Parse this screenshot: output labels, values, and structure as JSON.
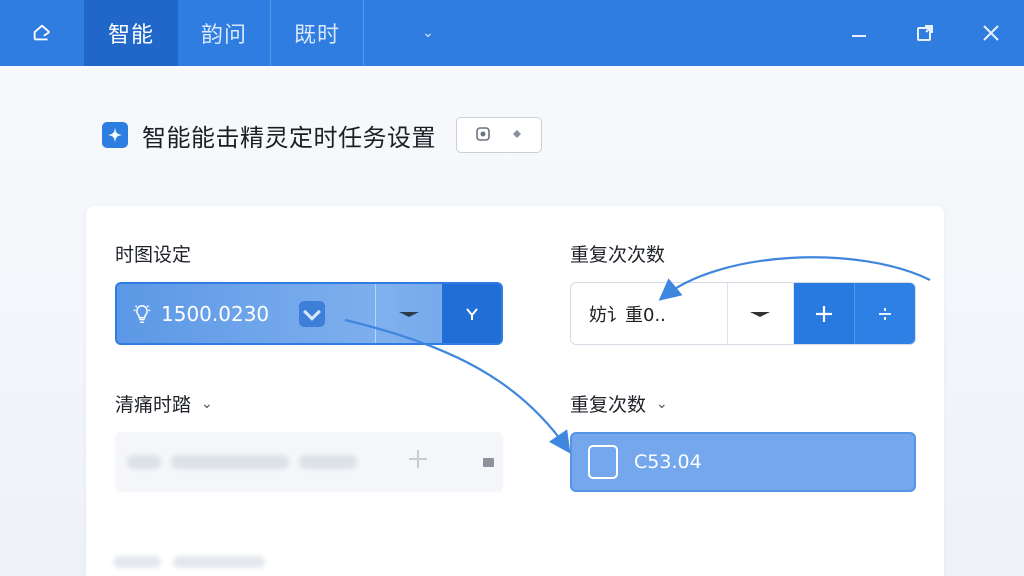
{
  "topbar": {
    "tabs": [
      {
        "label": "智能",
        "active": true
      },
      {
        "label": "韵问",
        "active": false
      },
      {
        "label": "既时",
        "active": false
      }
    ],
    "dropdown_glyph": "⌄"
  },
  "header": {
    "title": "智能能击精灵定时任务设置"
  },
  "form": {
    "time_label": "时图设定",
    "time_value": "1500.0230",
    "repeat_label": "重复次次数",
    "repeat_value": "妨讠重0..",
    "clear_label": "清痛时踏",
    "clear_chevron": "⌄",
    "repeat2_label": "重复次数",
    "repeat2_chevron": "⌄",
    "repeat2_value": "C53.04"
  },
  "colors": {
    "accent": "#2f7de0",
    "accent_dark": "#2067c9",
    "selected_fill": "#74a7ec"
  }
}
